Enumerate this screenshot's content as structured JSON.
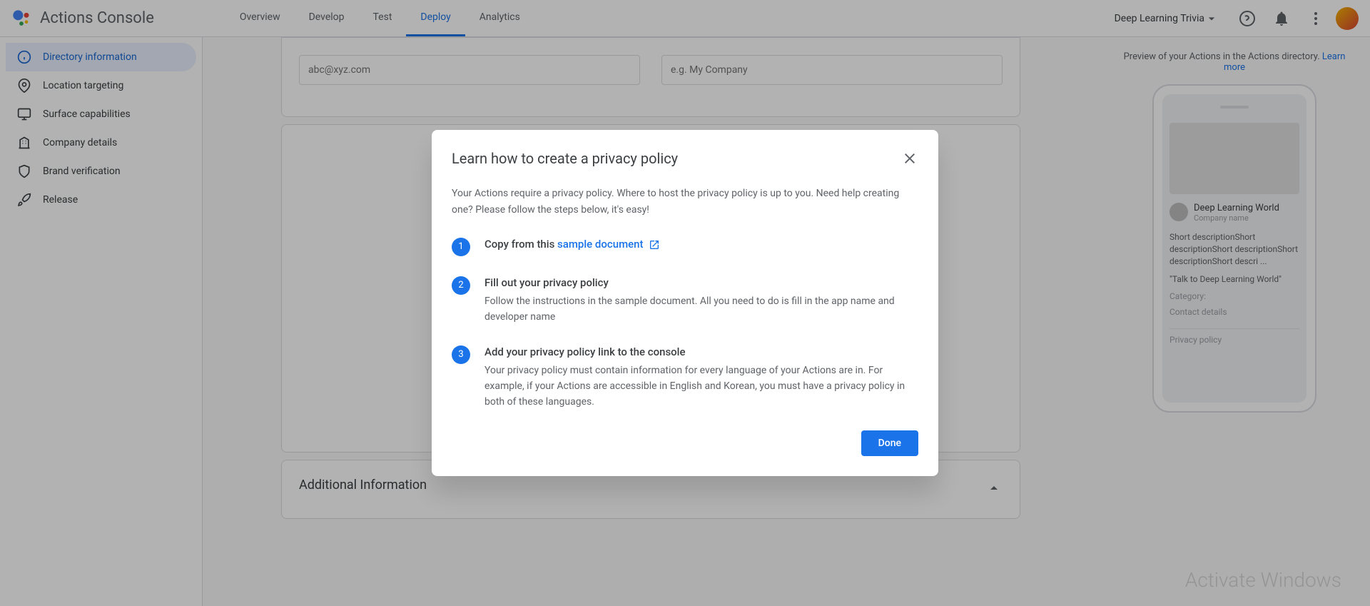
{
  "header": {
    "app_title": "Actions Console",
    "project_name": "Deep Learning Trivia"
  },
  "nav": {
    "tabs": [
      {
        "label": "Overview"
      },
      {
        "label": "Develop"
      },
      {
        "label": "Test"
      },
      {
        "label": "Deploy"
      },
      {
        "label": "Analytics"
      }
    ]
  },
  "sidebar": {
    "items": [
      {
        "label": "Directory information"
      },
      {
        "label": "Location targeting"
      },
      {
        "label": "Surface capabilities"
      },
      {
        "label": "Company details"
      },
      {
        "label": "Brand verification"
      },
      {
        "label": "Release"
      }
    ]
  },
  "form": {
    "email_placeholder": "abc@xyz.com",
    "company_placeholder": "e.g. My Company",
    "additional_info_title": "Additional Information"
  },
  "preview": {
    "text_prefix": "Preview of your Actions in the Actions directory. ",
    "learn_more": "Learn more",
    "card_title": "Deep Learning World",
    "card_subtitle": "Company name",
    "description": "Short descriptionShort descriptionShort descriptionShort descriptionShort descri ...",
    "quote": "\"Talk to Deep Learning World\"",
    "category_label": "Category:",
    "contact_label": "Contact details",
    "privacy_label": "Privacy policy"
  },
  "modal": {
    "title": "Learn how to create a privacy policy",
    "intro": "Your Actions require a privacy policy. Where to host the privacy policy is up to you. Need help creating one? Please follow the steps below, it's easy!",
    "steps": [
      {
        "num": "1",
        "title_prefix": "Copy from this ",
        "link_text": "sample document",
        "desc": ""
      },
      {
        "num": "2",
        "title": "Fill out your privacy policy",
        "desc": "Follow the instructions in the sample document. All you need to do is fill in the app name and developer name"
      },
      {
        "num": "3",
        "title": "Add your privacy policy link to the console",
        "desc": "Your privacy policy must contain information for every language of your Actions are in. For example, if your Actions are accessible in English and Korean, you must have a privacy policy in both of these languages."
      }
    ],
    "done_button": "Done"
  },
  "watermark": "Activate Windows"
}
